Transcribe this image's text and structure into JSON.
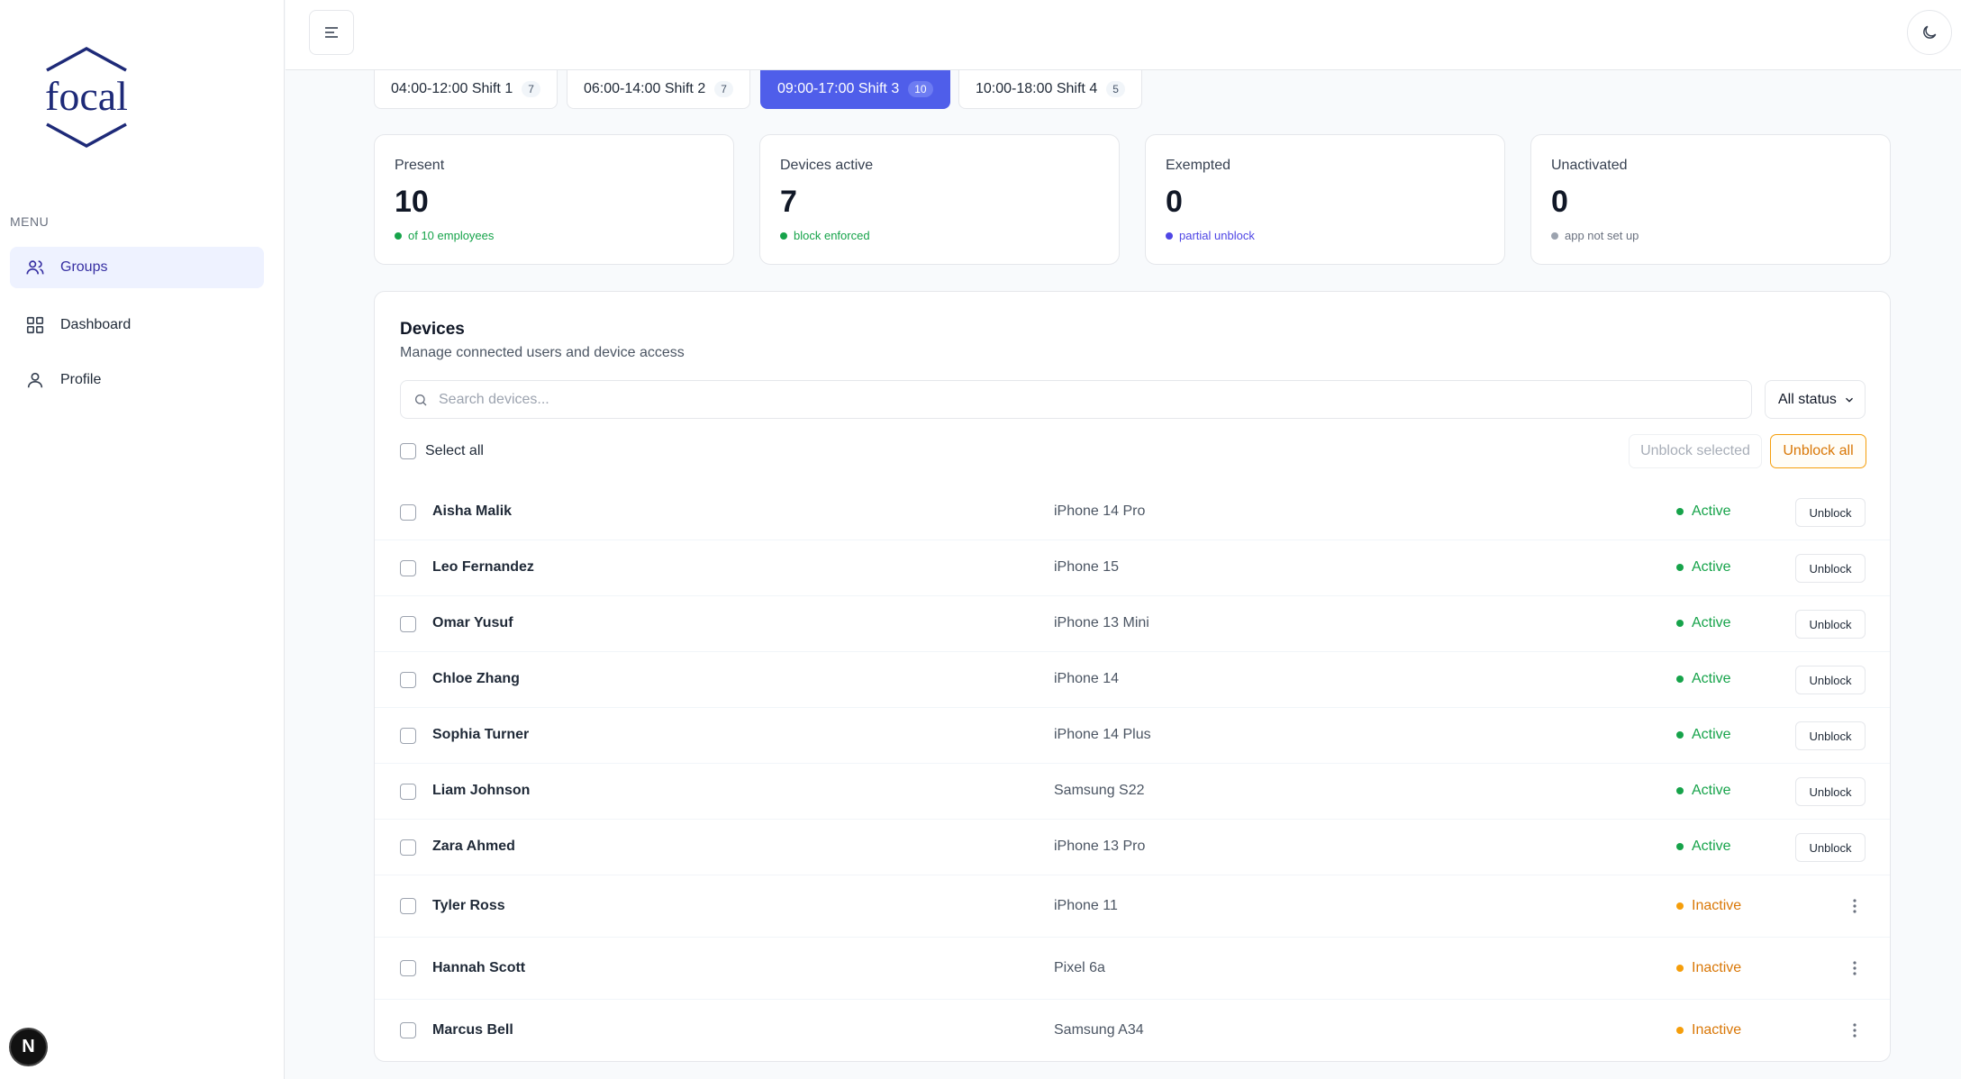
{
  "app": {
    "logo_text": "focal",
    "menu_label": "MENU",
    "user_initial": "N"
  },
  "sidebar": {
    "items": [
      {
        "label": "Groups",
        "icon": "users-icon",
        "active": true
      },
      {
        "label": "Dashboard",
        "icon": "grid-icon",
        "active": false
      },
      {
        "label": "Profile",
        "icon": "user-icon",
        "active": false
      }
    ]
  },
  "shifts": [
    {
      "label": "04:00-12:00 Shift 1",
      "count": "7",
      "active": false
    },
    {
      "label": "06:00-14:00 Shift 2",
      "count": "7",
      "active": false
    },
    {
      "label": "09:00-17:00 Shift 3",
      "count": "10",
      "active": true
    },
    {
      "label": "10:00-18:00 Shift 4",
      "count": "5",
      "active": false
    }
  ],
  "stats": [
    {
      "label": "Present",
      "value": "10",
      "note": "of 10 employees",
      "color": "#16a34a"
    },
    {
      "label": "Devices active",
      "value": "7",
      "note": "block enforced",
      "color": "#16a34a"
    },
    {
      "label": "Exempted",
      "value": "0",
      "note": "partial unblock",
      "color": "#4f46e5"
    },
    {
      "label": "Unactivated",
      "value": "0",
      "note": "app not set up",
      "color": "#6b7280"
    }
  ],
  "devices": {
    "title": "Devices",
    "subtitle": "Manage connected users and device access",
    "search_placeholder": "Search devices...",
    "status_filter": "All status",
    "select_all_label": "Select all",
    "unblock_selected_label": "Unblock selected",
    "unblock_all_label": "Unblock all",
    "row_action_label": "Unblock",
    "rows": [
      {
        "name": "Aisha Malik",
        "device": "iPhone 14 Pro",
        "status": "Active"
      },
      {
        "name": "Leo Fernandez",
        "device": "iPhone 15",
        "status": "Active"
      },
      {
        "name": "Omar Yusuf",
        "device": "iPhone 13 Mini",
        "status": "Active"
      },
      {
        "name": "Chloe Zhang",
        "device": "iPhone 14",
        "status": "Active"
      },
      {
        "name": "Sophia Turner",
        "device": "iPhone 14 Plus",
        "status": "Active"
      },
      {
        "name": "Liam Johnson",
        "device": "Samsung S22",
        "status": "Active"
      },
      {
        "name": "Zara Ahmed",
        "device": "iPhone 13 Pro",
        "status": "Active"
      },
      {
        "name": "Tyler Ross",
        "device": "iPhone 11",
        "status": "Inactive"
      },
      {
        "name": "Hannah Scott",
        "device": "Pixel 6a",
        "status": "Inactive"
      },
      {
        "name": "Marcus Bell",
        "device": "Samsung A34",
        "status": "Inactive"
      }
    ]
  },
  "colors": {
    "accent": "#4f5eea",
    "active": "#16a34a",
    "inactive": "#f59e0b",
    "logo": "#1e2a78"
  }
}
